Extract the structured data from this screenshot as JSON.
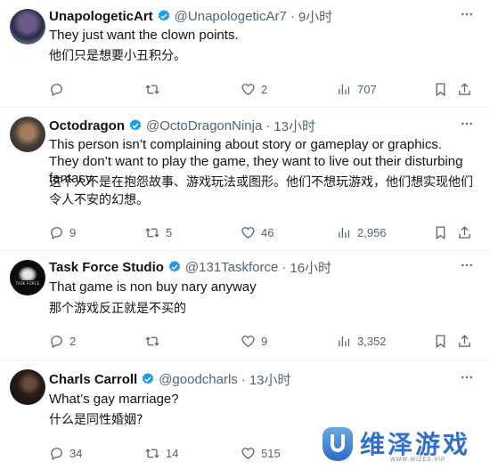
{
  "posts": [
    {
      "name": "UnapologeticArt",
      "handle": "@UnapologeticAr7",
      "time": "9小时",
      "text": "They just want the clown points.",
      "translation": "他们只是想要小丑积分。",
      "replies": "",
      "reposts": "",
      "likes": "2",
      "views": "707"
    },
    {
      "name": "Octodragon",
      "handle": "@OctoDragonNinja",
      "time": "13小时",
      "text": "This person isn’t complaining about story or gameplay or graphics. They don’t want to play the game, they want to live out their disturbing fantasy.",
      "translation_line1": "这个人不是在抱怨故事、游戏玩法或图形。他们不想玩游戏，他们想实现他们",
      "translation_line2": "令人不安的幻想。",
      "replies": "9",
      "reposts": "5",
      "likes": "46",
      "views": "2,956"
    },
    {
      "name": "Task Force Studio",
      "handle": "@131Taskforce",
      "time": "16小时",
      "avatar_text": "TASK FORCE",
      "text": "That game is non buy nary anyway",
      "translation": "那个游戏反正就是不买的",
      "replies": "2",
      "reposts": "",
      "likes": "9",
      "views": "3,352"
    },
    {
      "name": "Charls Carroll",
      "handle": "@goodcharls",
      "time": "13小时",
      "text": "What’s gay marriage?",
      "translation": "什么是同性婚姻?",
      "replies": "34",
      "reposts": "14",
      "likes": "515",
      "views": ""
    }
  ],
  "watermark": {
    "cn": "维泽游戏",
    "en": "WWW.WIZED.VIP"
  },
  "colors": {
    "verified": "#1d9bf0",
    "muted": "#536471",
    "text": "#0f1419",
    "divider": "#eff3f4"
  },
  "icons": [
    "reply-icon",
    "repost-icon",
    "like-icon",
    "views-icon",
    "bookmark-icon",
    "share-icon",
    "more-icon",
    "verified-badge-icon"
  ]
}
